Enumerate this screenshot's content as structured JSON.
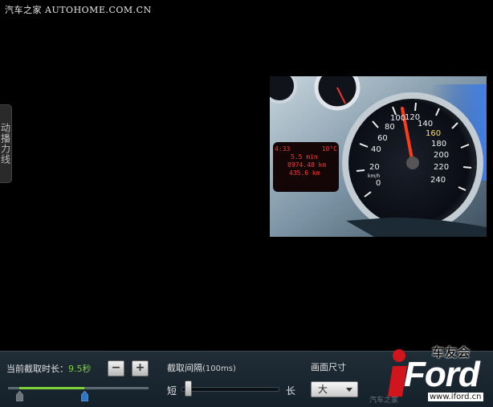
{
  "watermark": {
    "text": "汽车之家 AUTOHOME.COM.CN"
  },
  "side_tab": {
    "label": "动播力线"
  },
  "preview": {
    "description_icon": "dashboard-photo",
    "speedo_ticks": [
      "0",
      "20",
      "40",
      "60",
      "80",
      "100",
      "120",
      "140",
      "160",
      "180",
      "200",
      "220",
      "240"
    ],
    "speed_unit": "km/h",
    "lcd_lines": [
      "4:33",
      "10°C",
      "5.5 min",
      "8974.48 km",
      "435.6 km"
    ]
  },
  "controls": {
    "duration_label": "当前截取时长：",
    "duration_value": "9.5秒",
    "minus_label": "−",
    "plus_label": "+",
    "range_start": 0.08,
    "range_end": 0.54,
    "interval_label": "截取间隔",
    "interval_unit": "(100ms)",
    "short_label": "短",
    "long_label": "长",
    "interval_position": 0.03,
    "size_label": "画面尺寸",
    "size_value": "大"
  },
  "logo": {
    "top_text": "车友会",
    "main_text": "Ford",
    "url": "www.iford.cn",
    "faint_text": "汽车之家"
  },
  "colors": {
    "accent_green": "#7fd13b",
    "logo_red": "#d0161c",
    "bar_bg": "#1a2630"
  }
}
